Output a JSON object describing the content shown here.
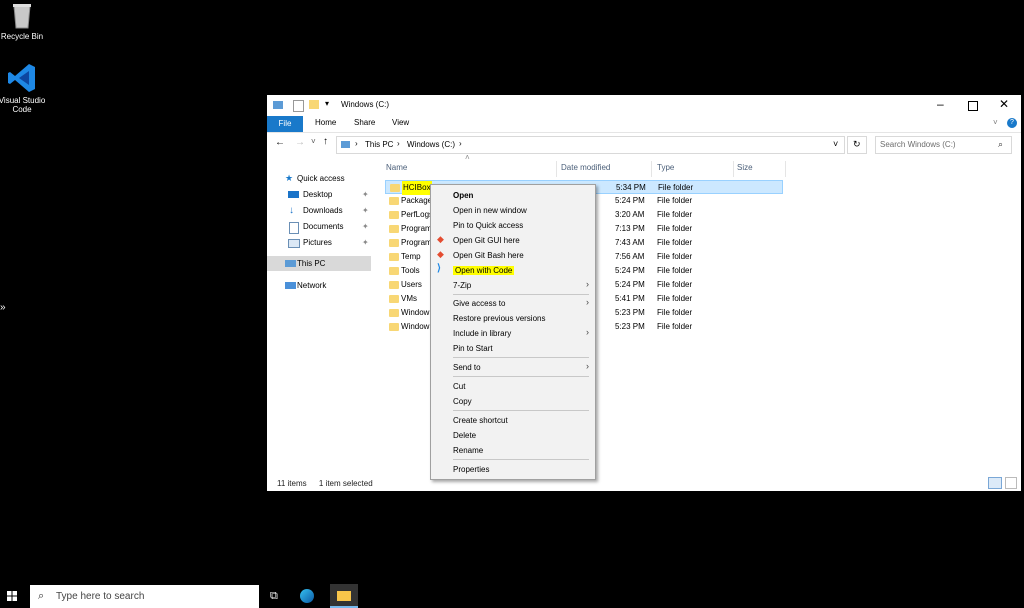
{
  "desktop": {
    "icons": [
      {
        "label": "Recycle Bin",
        "icon": "recycle-bin-icon"
      },
      {
        "label": "Visual Studio Code",
        "icon": "vscode-icon"
      }
    ]
  },
  "window": {
    "title": "Windows (C:)",
    "ribbon_tabs": [
      "File",
      "Home",
      "Share",
      "View"
    ],
    "breadcrumb": [
      "This PC",
      "Windows (C:)"
    ],
    "search_placeholder": "Search Windows (C:)",
    "nav": {
      "quick_access": "Quick access",
      "items": [
        {
          "label": "Desktop",
          "icon": "desktop-icon"
        },
        {
          "label": "Downloads",
          "icon": "downloads-icon"
        },
        {
          "label": "Documents",
          "icon": "documents-icon"
        },
        {
          "label": "Pictures",
          "icon": "pictures-icon"
        }
      ],
      "this_pc": "This PC",
      "network": "Network"
    },
    "columns": [
      "Name",
      "Date modified",
      "Type",
      "Size"
    ],
    "files": [
      {
        "name": "HCIBox",
        "date": "5:34 PM",
        "type": "File folder",
        "selected": true
      },
      {
        "name": "Package",
        "date": "5:24 PM",
        "type": "File folder"
      },
      {
        "name": "PerfLogs",
        "date": "3:20 AM",
        "type": "File folder"
      },
      {
        "name": "Program",
        "date": "7:13 PM",
        "type": "File folder"
      },
      {
        "name": "Program",
        "date": "7:43 AM",
        "type": "File folder"
      },
      {
        "name": "Temp",
        "date": "7:56 AM",
        "type": "File folder"
      },
      {
        "name": "Tools",
        "date": "5:24 PM",
        "type": "File folder"
      },
      {
        "name": "Users",
        "date": "5:24 PM",
        "type": "File folder"
      },
      {
        "name": "VMs",
        "date": "5:41 PM",
        "type": "File folder"
      },
      {
        "name": "Window",
        "date": "5:23 PM",
        "type": "File folder"
      },
      {
        "name": "Window",
        "date": "5:23 PM",
        "type": "File folder"
      }
    ],
    "status": {
      "count": "11 items",
      "selected": "1 item selected"
    }
  },
  "context_menu": [
    {
      "label": "Open",
      "bold": true
    },
    {
      "label": "Open in new window"
    },
    {
      "label": "Pin to Quick access"
    },
    {
      "label": "Open Git GUI here",
      "icon": "git-icon"
    },
    {
      "label": "Open Git Bash here",
      "icon": "git-icon"
    },
    {
      "label": "Open with Code",
      "icon": "vscode-icon",
      "highlight": true
    },
    {
      "label": "7-Zip",
      "submenu": true
    },
    {
      "label": "Give access to",
      "submenu": true
    },
    {
      "label": "Restore previous versions"
    },
    {
      "label": "Include in library",
      "submenu": true
    },
    {
      "label": "Pin to Start"
    },
    {
      "label": "Send to",
      "submenu": true
    },
    {
      "label": "Cut"
    },
    {
      "label": "Copy"
    },
    {
      "label": "Create shortcut"
    },
    {
      "label": "Delete"
    },
    {
      "label": "Rename"
    },
    {
      "label": "Properties"
    }
  ],
  "taskbar": {
    "search_placeholder": "Type here to search"
  },
  "colors": {
    "accent": "#1979ca",
    "selection": "#cce8ff",
    "highlight": "#ffff00",
    "folder": "#f8d775"
  }
}
